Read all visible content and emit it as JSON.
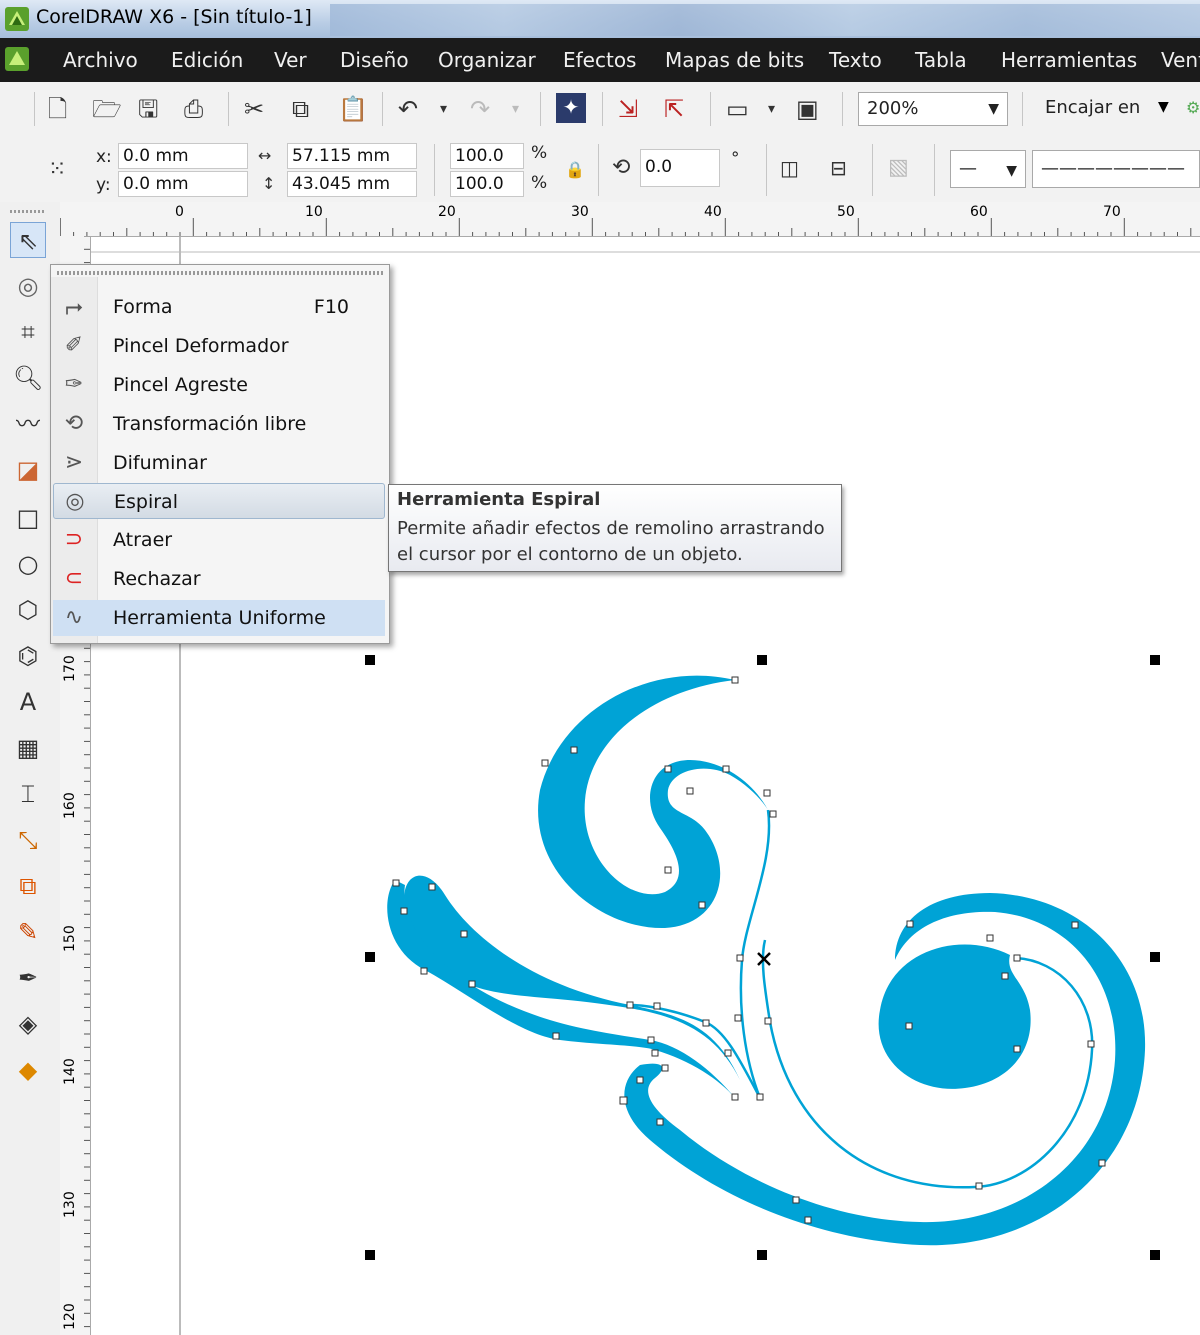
{
  "window": {
    "title": "CorelDRAW X6 - [Sin título-1]"
  },
  "menubar": {
    "items": [
      "Archivo",
      "Edición",
      "Ver",
      "Diseño",
      "Organizar",
      "Efectos",
      "Mapas de bits",
      "Texto",
      "Tabla",
      "Herramientas",
      "Ventana"
    ]
  },
  "standard_toolbar": {
    "zoom": "200%",
    "snap_label": "Encajar en"
  },
  "property_bar": {
    "x_label": "x:",
    "x_value": "0.0 mm",
    "y_label": "y:",
    "y_value": "0.0 mm",
    "width": "57.115 mm",
    "height": "43.045 mm",
    "scale_x": "100.0",
    "scale_y": "100.0",
    "percent": "%",
    "rotation": "0.0",
    "degree": "°"
  },
  "ruler": {
    "horizontal_ticks": [
      "0",
      "10",
      "20",
      "30",
      "40",
      "50",
      "60",
      "70"
    ],
    "vertical_ticks": [
      "170",
      "160",
      "150",
      "140",
      "130",
      "120"
    ]
  },
  "flyout": {
    "items": [
      {
        "label": "Forma",
        "shortcut": "F10",
        "icon": "shape-tool-icon"
      },
      {
        "label": "Pincel Deformador",
        "shortcut": "",
        "icon": "smudge-brush-icon"
      },
      {
        "label": "Pincel Agreste",
        "shortcut": "",
        "icon": "roughen-brush-icon"
      },
      {
        "label": "Transformación libre",
        "shortcut": "",
        "icon": "free-transform-icon"
      },
      {
        "label": "Difuminar",
        "shortcut": "",
        "icon": "smear-icon"
      },
      {
        "label": "Espiral",
        "shortcut": "",
        "icon": "twirl-icon"
      },
      {
        "label": "Atraer",
        "shortcut": "",
        "icon": "attract-icon"
      },
      {
        "label": "Rechazar",
        "shortcut": "",
        "icon": "repel-icon"
      },
      {
        "label": "Herramienta Uniforme",
        "shortcut": "",
        "icon": "smooth-tool-icon"
      }
    ],
    "selected_index": 5,
    "hover_index": 8
  },
  "tooltip": {
    "title": "Herramienta Espiral",
    "description": "Permite añadir efectos de remolino arrastrando el cursor por el contorno de un objeto."
  },
  "colors": {
    "shape_fill": "#00a3d6",
    "menubar_bg": "#1b1b1b",
    "selection_handle": "#000000"
  }
}
